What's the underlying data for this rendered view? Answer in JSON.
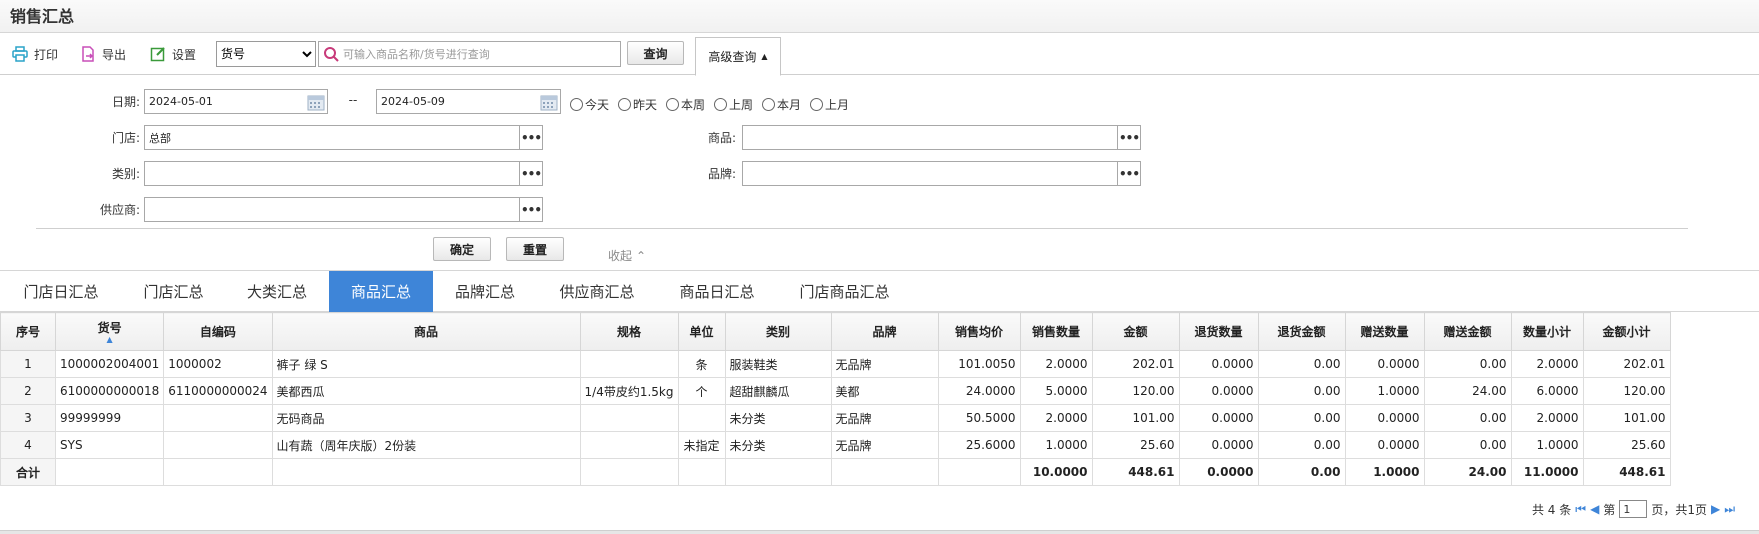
{
  "title": "销售汇总",
  "toolbar": {
    "print": "打印",
    "export": "导出",
    "settings": "设置",
    "type_select": "货号",
    "search_placeholder": "可输入商品名称/货号进行查询",
    "query": "查询",
    "advanced": "高级查询"
  },
  "filter": {
    "date_label": "日期:",
    "date_from": "2024-05-01",
    "date_sep": "--",
    "date_to": "2024-05-09",
    "quick": [
      "今天",
      "昨天",
      "本周",
      "上周",
      "本月",
      "上月"
    ],
    "store_label": "门店:",
    "store_value": "总部",
    "product_label": "商品:",
    "category_label": "类别:",
    "brand_label": "品牌:",
    "supplier_label": "供应商:",
    "confirm": "确定",
    "reset": "重置",
    "collapse": "收起"
  },
  "tabs": [
    "门店日汇总",
    "门店汇总",
    "大类汇总",
    "商品汇总",
    "品牌汇总",
    "供应商汇总",
    "商品日汇总",
    "门店商品汇总"
  ],
  "active_tab": "商品汇总",
  "table": {
    "headers": [
      "序号",
      "货号",
      "自编码",
      "商品",
      "规格",
      "单位",
      "类别",
      "品牌",
      "销售均价",
      "销售数量",
      "金额",
      "退货数量",
      "退货金额",
      "赠送数量",
      "赠送金额",
      "数量小计",
      "金额小计"
    ],
    "rows": [
      [
        "1",
        "1000002004001",
        "1000002",
        "裤子 绿 S",
        "",
        "条",
        "服装鞋类",
        "无品牌",
        "101.0050",
        "2.0000",
        "202.01",
        "0.0000",
        "0.00",
        "0.0000",
        "0.00",
        "2.0000",
        "202.01"
      ],
      [
        "2",
        "6100000000018",
        "6110000000024",
        "美都西瓜",
        "1/4带皮约1.5kg",
        "个",
        "超甜麒麟瓜",
        "美都",
        "24.0000",
        "5.0000",
        "120.00",
        "0.0000",
        "0.00",
        "1.0000",
        "24.00",
        "6.0000",
        "120.00"
      ],
      [
        "3",
        "99999999",
        "",
        "无码商品",
        "",
        "",
        "未分类",
        "无品牌",
        "50.5000",
        "2.0000",
        "101.00",
        "0.0000",
        "0.00",
        "0.0000",
        "0.00",
        "2.0000",
        "101.00"
      ],
      [
        "4",
        "SYS",
        "",
        "山有蔬（周年庆版）2份装",
        "",
        "未指定",
        "未分类",
        "无品牌",
        "25.6000",
        "1.0000",
        "25.60",
        "0.0000",
        "0.00",
        "0.0000",
        "0.00",
        "1.0000",
        "25.60"
      ]
    ],
    "total": [
      "合计",
      "",
      "",
      "",
      "",
      "",
      "",
      "",
      "",
      "10.0000",
      "448.61",
      "0.0000",
      "0.00",
      "1.0000",
      "24.00",
      "11.0000",
      "448.61"
    ]
  },
  "pager": {
    "total": "共 4 条",
    "page_prefix": "第",
    "page": "1",
    "page_suffix": "页，共1页"
  },
  "colors": {
    "accent": "#3e85d8",
    "print": "#2aa3c9",
    "export": "#c84fb8",
    "settings": "#3a9a3a"
  }
}
